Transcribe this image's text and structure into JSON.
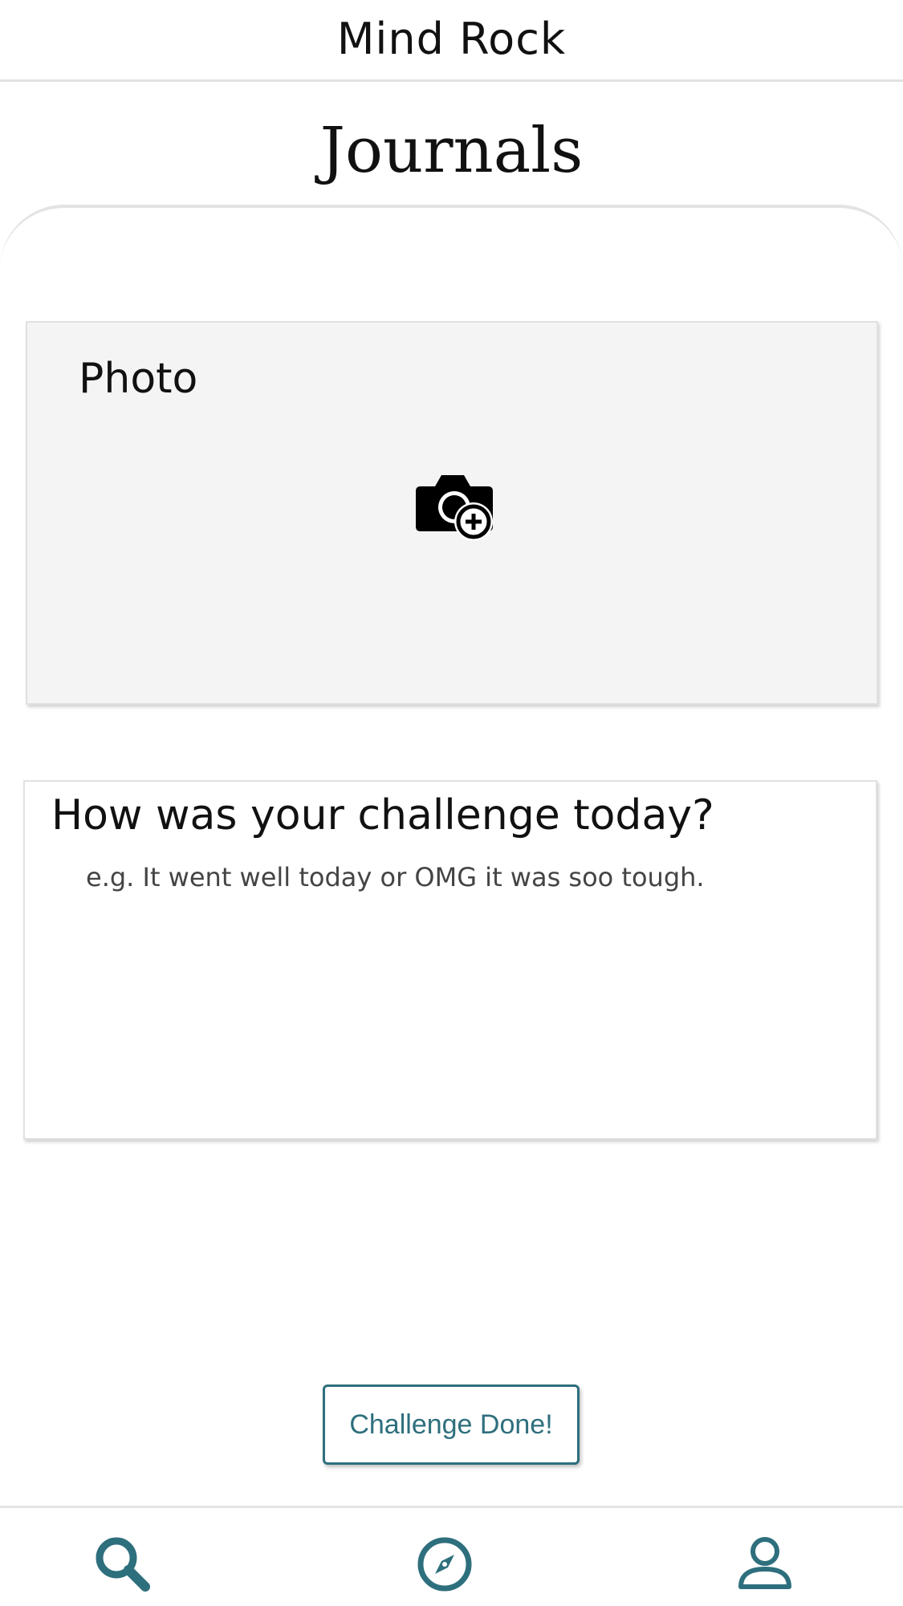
{
  "header": {
    "app_title": "Mind Rock"
  },
  "page": {
    "title": "Journals"
  },
  "photo_card": {
    "label": "Photo",
    "icon": "camera-add-icon"
  },
  "entry_card": {
    "question": "How was your challenge today?",
    "placeholder": "e.g. It went well today or OMG it was soo tough.",
    "value": ""
  },
  "actions": {
    "done_label": "Challenge Done!"
  },
  "bottom_nav": {
    "items": [
      {
        "icon": "search-icon"
      },
      {
        "icon": "compass-icon"
      },
      {
        "icon": "profile-icon"
      }
    ]
  },
  "colors": {
    "accent": "#2e6f7d",
    "card_background": "#f4f4f4"
  }
}
